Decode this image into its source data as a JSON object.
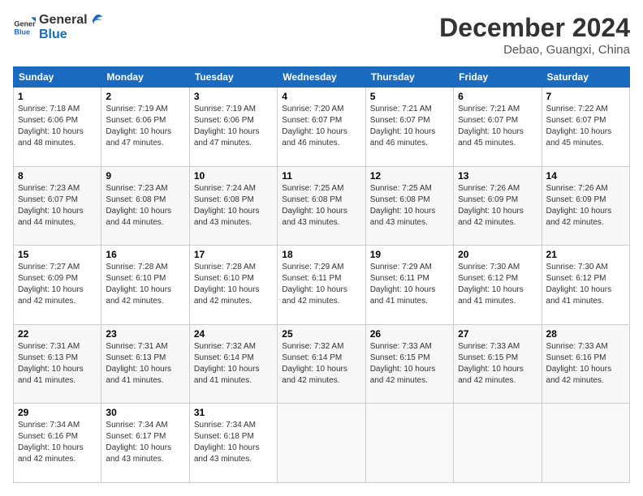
{
  "logo": {
    "line1": "General",
    "line2": "Blue"
  },
  "header": {
    "title": "December 2024",
    "location": "Debao, Guangxi, China"
  },
  "weekdays": [
    "Sunday",
    "Monday",
    "Tuesday",
    "Wednesday",
    "Thursday",
    "Friday",
    "Saturday"
  ],
  "weeks": [
    [
      {
        "day": "1",
        "sunrise": "7:18 AM",
        "sunset": "6:06 PM",
        "daylight": "10 hours and 48 minutes."
      },
      {
        "day": "2",
        "sunrise": "7:19 AM",
        "sunset": "6:06 PM",
        "daylight": "10 hours and 47 minutes."
      },
      {
        "day": "3",
        "sunrise": "7:19 AM",
        "sunset": "6:06 PM",
        "daylight": "10 hours and 47 minutes."
      },
      {
        "day": "4",
        "sunrise": "7:20 AM",
        "sunset": "6:07 PM",
        "daylight": "10 hours and 46 minutes."
      },
      {
        "day": "5",
        "sunrise": "7:21 AM",
        "sunset": "6:07 PM",
        "daylight": "10 hours and 46 minutes."
      },
      {
        "day": "6",
        "sunrise": "7:21 AM",
        "sunset": "6:07 PM",
        "daylight": "10 hours and 45 minutes."
      },
      {
        "day": "7",
        "sunrise": "7:22 AM",
        "sunset": "6:07 PM",
        "daylight": "10 hours and 45 minutes."
      }
    ],
    [
      {
        "day": "8",
        "sunrise": "7:23 AM",
        "sunset": "6:07 PM",
        "daylight": "10 hours and 44 minutes."
      },
      {
        "day": "9",
        "sunrise": "7:23 AM",
        "sunset": "6:08 PM",
        "daylight": "10 hours and 44 minutes."
      },
      {
        "day": "10",
        "sunrise": "7:24 AM",
        "sunset": "6:08 PM",
        "daylight": "10 hours and 43 minutes."
      },
      {
        "day": "11",
        "sunrise": "7:25 AM",
        "sunset": "6:08 PM",
        "daylight": "10 hours and 43 minutes."
      },
      {
        "day": "12",
        "sunrise": "7:25 AM",
        "sunset": "6:08 PM",
        "daylight": "10 hours and 43 minutes."
      },
      {
        "day": "13",
        "sunrise": "7:26 AM",
        "sunset": "6:09 PM",
        "daylight": "10 hours and 42 minutes."
      },
      {
        "day": "14",
        "sunrise": "7:26 AM",
        "sunset": "6:09 PM",
        "daylight": "10 hours and 42 minutes."
      }
    ],
    [
      {
        "day": "15",
        "sunrise": "7:27 AM",
        "sunset": "6:09 PM",
        "daylight": "10 hours and 42 minutes."
      },
      {
        "day": "16",
        "sunrise": "7:28 AM",
        "sunset": "6:10 PM",
        "daylight": "10 hours and 42 minutes."
      },
      {
        "day": "17",
        "sunrise": "7:28 AM",
        "sunset": "6:10 PM",
        "daylight": "10 hours and 42 minutes."
      },
      {
        "day": "18",
        "sunrise": "7:29 AM",
        "sunset": "6:11 PM",
        "daylight": "10 hours and 42 minutes."
      },
      {
        "day": "19",
        "sunrise": "7:29 AM",
        "sunset": "6:11 PM",
        "daylight": "10 hours and 41 minutes."
      },
      {
        "day": "20",
        "sunrise": "7:30 AM",
        "sunset": "6:12 PM",
        "daylight": "10 hours and 41 minutes."
      },
      {
        "day": "21",
        "sunrise": "7:30 AM",
        "sunset": "6:12 PM",
        "daylight": "10 hours and 41 minutes."
      }
    ],
    [
      {
        "day": "22",
        "sunrise": "7:31 AM",
        "sunset": "6:13 PM",
        "daylight": "10 hours and 41 minutes."
      },
      {
        "day": "23",
        "sunrise": "7:31 AM",
        "sunset": "6:13 PM",
        "daylight": "10 hours and 41 minutes."
      },
      {
        "day": "24",
        "sunrise": "7:32 AM",
        "sunset": "6:14 PM",
        "daylight": "10 hours and 41 minutes."
      },
      {
        "day": "25",
        "sunrise": "7:32 AM",
        "sunset": "6:14 PM",
        "daylight": "10 hours and 42 minutes."
      },
      {
        "day": "26",
        "sunrise": "7:33 AM",
        "sunset": "6:15 PM",
        "daylight": "10 hours and 42 minutes."
      },
      {
        "day": "27",
        "sunrise": "7:33 AM",
        "sunset": "6:15 PM",
        "daylight": "10 hours and 42 minutes."
      },
      {
        "day": "28",
        "sunrise": "7:33 AM",
        "sunset": "6:16 PM",
        "daylight": "10 hours and 42 minutes."
      }
    ],
    [
      {
        "day": "29",
        "sunrise": "7:34 AM",
        "sunset": "6:16 PM",
        "daylight": "10 hours and 42 minutes."
      },
      {
        "day": "30",
        "sunrise": "7:34 AM",
        "sunset": "6:17 PM",
        "daylight": "10 hours and 43 minutes."
      },
      {
        "day": "31",
        "sunrise": "7:34 AM",
        "sunset": "6:18 PM",
        "daylight": "10 hours and 43 minutes."
      },
      null,
      null,
      null,
      null
    ]
  ],
  "labels": {
    "sunrise_prefix": "Sunrise: ",
    "sunset_prefix": "Sunset: ",
    "daylight_prefix": "Daylight: "
  }
}
